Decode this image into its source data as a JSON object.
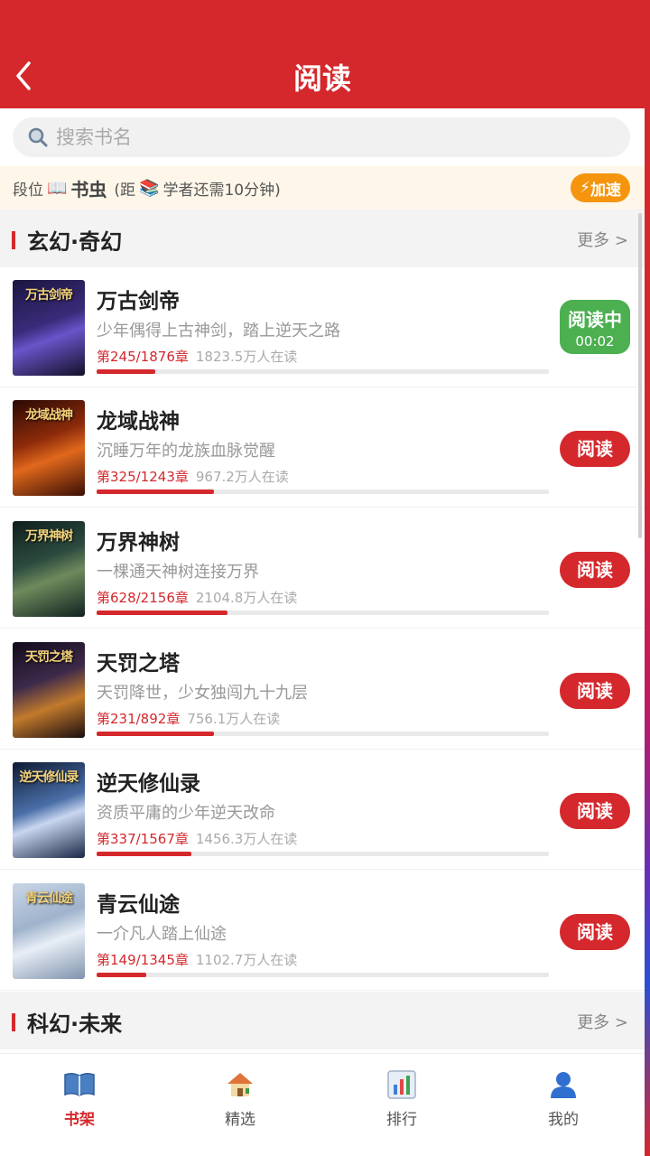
{
  "header": {
    "title": "阅读"
  },
  "search": {
    "placeholder": "搜索书名"
  },
  "rank": {
    "prefix": "段位",
    "level": "书虫",
    "hint": "(距",
    "hint2": "学者还需10分钟)",
    "boost": "加速"
  },
  "sections": [
    {
      "name": "玄幻·奇幻",
      "more": "更多 >"
    },
    {
      "name": "科幻·未来",
      "more": "更多 >"
    }
  ],
  "books": [
    {
      "title": "万古剑帝",
      "desc": "少年偶得上古神剑，踏上逆天之路",
      "chapter": "第245/1876章",
      "readers": "1823.5万人在读",
      "progress": 0.13,
      "status": "reading",
      "btn": "阅读中",
      "time": "00:02"
    },
    {
      "title": "龙域战神",
      "desc": "沉睡万年的龙族血脉觉醒",
      "chapter": "第325/1243章",
      "readers": "967.2万人在读",
      "progress": 0.26,
      "status": "read",
      "btn": "阅读"
    },
    {
      "title": "万界神树",
      "desc": "一棵通天神树连接万界",
      "chapter": "第628/2156章",
      "readers": "2104.8万人在读",
      "progress": 0.29,
      "status": "read",
      "btn": "阅读"
    },
    {
      "title": "天罚之塔",
      "desc": "天罚降世，少女独闯九十九层",
      "chapter": "第231/892章",
      "readers": "756.1万人在读",
      "progress": 0.26,
      "status": "read",
      "btn": "阅读"
    },
    {
      "title": "逆天修仙录",
      "desc": "资质平庸的少年逆天改命",
      "chapter": "第337/1567章",
      "readers": "1456.3万人在读",
      "progress": 0.21,
      "status": "read",
      "btn": "阅读"
    },
    {
      "title": "青云仙途",
      "desc": "一介凡人踏上仙途",
      "chapter": "第149/1345章",
      "readers": "1102.7万人在读",
      "progress": 0.11,
      "status": "read",
      "btn": "阅读"
    }
  ],
  "tabs": [
    {
      "label": "书架",
      "icon": "book-icon",
      "active": true
    },
    {
      "label": "精选",
      "icon": "house-icon",
      "active": false
    },
    {
      "label": "排行",
      "icon": "chart-icon",
      "active": false
    },
    {
      "label": "我的",
      "icon": "user-icon",
      "active": false
    }
  ],
  "colors": {
    "brand": "#d4282d",
    "reading": "#4caf50",
    "boost": "#f5950d"
  }
}
